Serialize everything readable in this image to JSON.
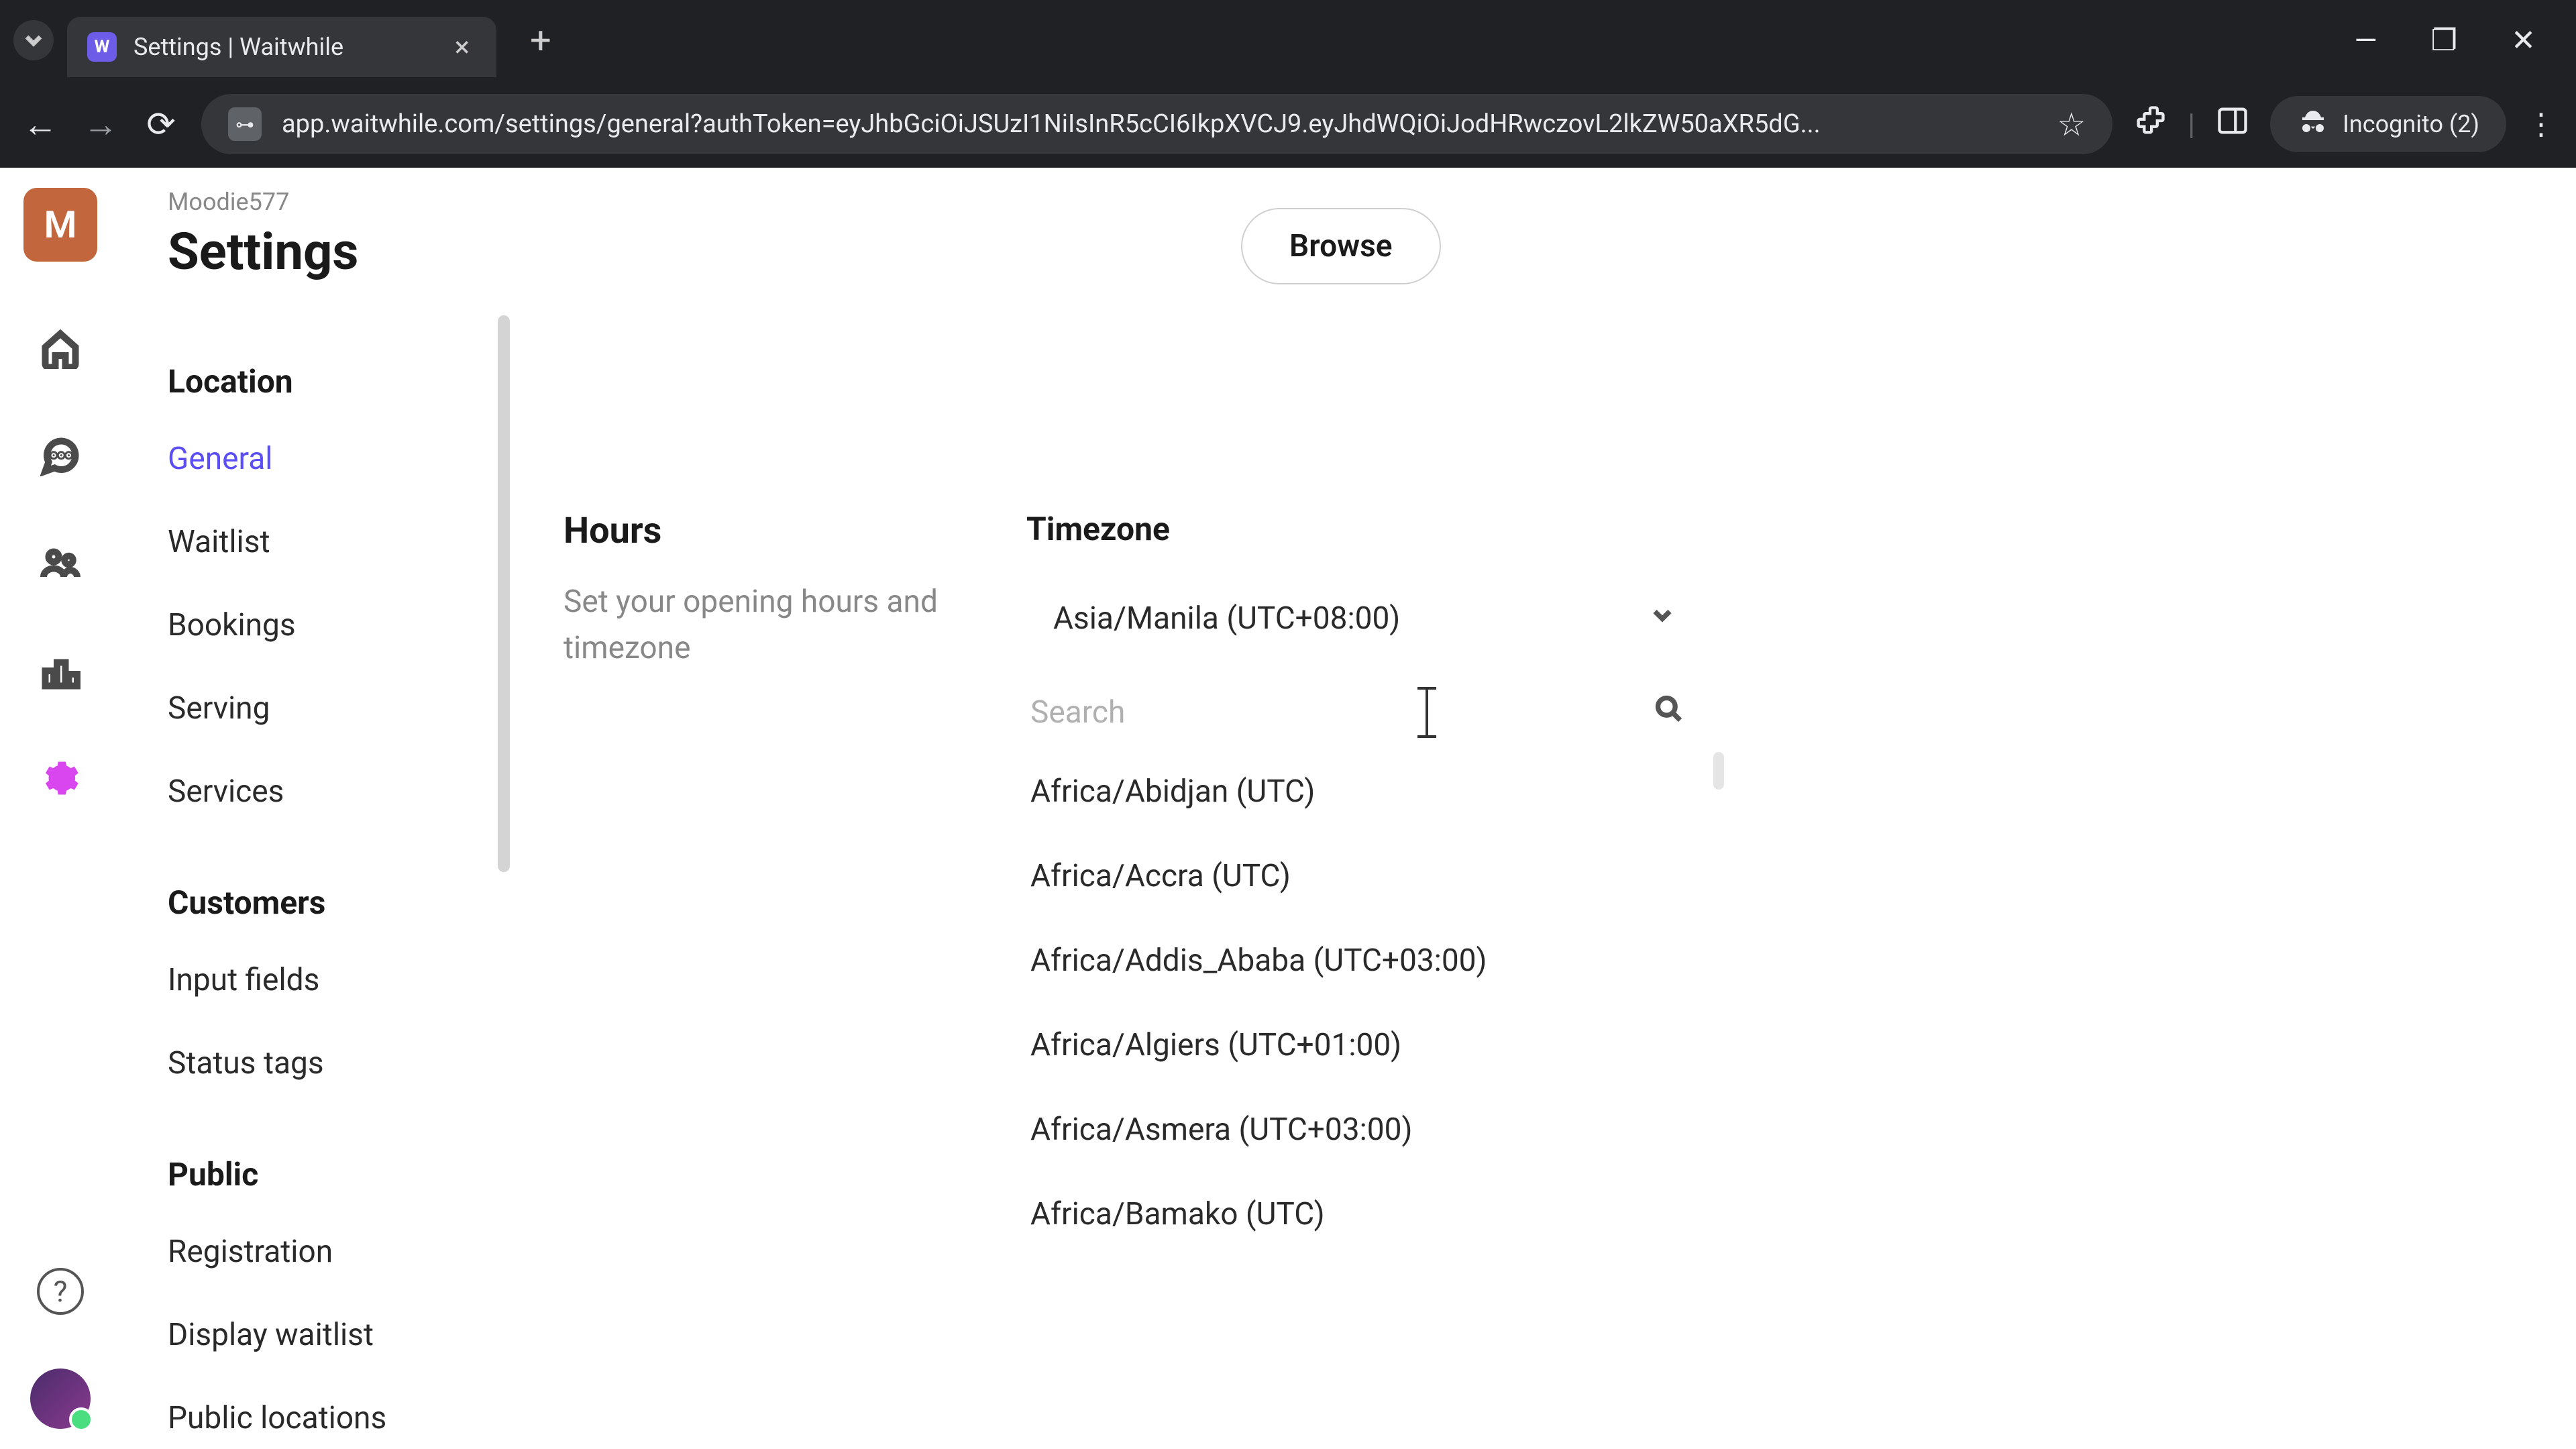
{
  "browser": {
    "tab_title": "Settings | Waitwhile",
    "url": "app.waitwhile.com/settings/general?authToken=eyJhbGciOiJSUzI1NiIsInR5cCI6IkpXVCJ9.eyJhdWQiOiJodHRwczovL2lkZW50aXR5dG...",
    "incognito_label": "Incognito (2)"
  },
  "header": {
    "org_initial": "M",
    "org_name": "Moodie577",
    "page_title": "Settings"
  },
  "nav": {
    "sections": [
      {
        "title": "Location",
        "items": [
          "General",
          "Waitlist",
          "Bookings",
          "Serving",
          "Services"
        ],
        "active": "General"
      },
      {
        "title": "Customers",
        "items": [
          "Input fields",
          "Status tags"
        ]
      },
      {
        "title": "Public",
        "items": [
          "Registration",
          "Display waitlist",
          "Public locations"
        ]
      }
    ]
  },
  "main": {
    "browse_label": "Browse",
    "hours": {
      "title": "Hours",
      "subtitle": "Set your opening hours and timezone"
    },
    "timezone": {
      "label": "Timezone",
      "selected": "Asia/Manila (UTC+08:00)",
      "search_placeholder": "Search",
      "options": [
        "Africa/Abidjan (UTC)",
        "Africa/Accra (UTC)",
        "Africa/Addis_Ababa (UTC+03:00)",
        "Africa/Algiers (UTC+01:00)",
        "Africa/Asmera (UTC+03:00)",
        "Africa/Bamako (UTC)"
      ]
    }
  }
}
